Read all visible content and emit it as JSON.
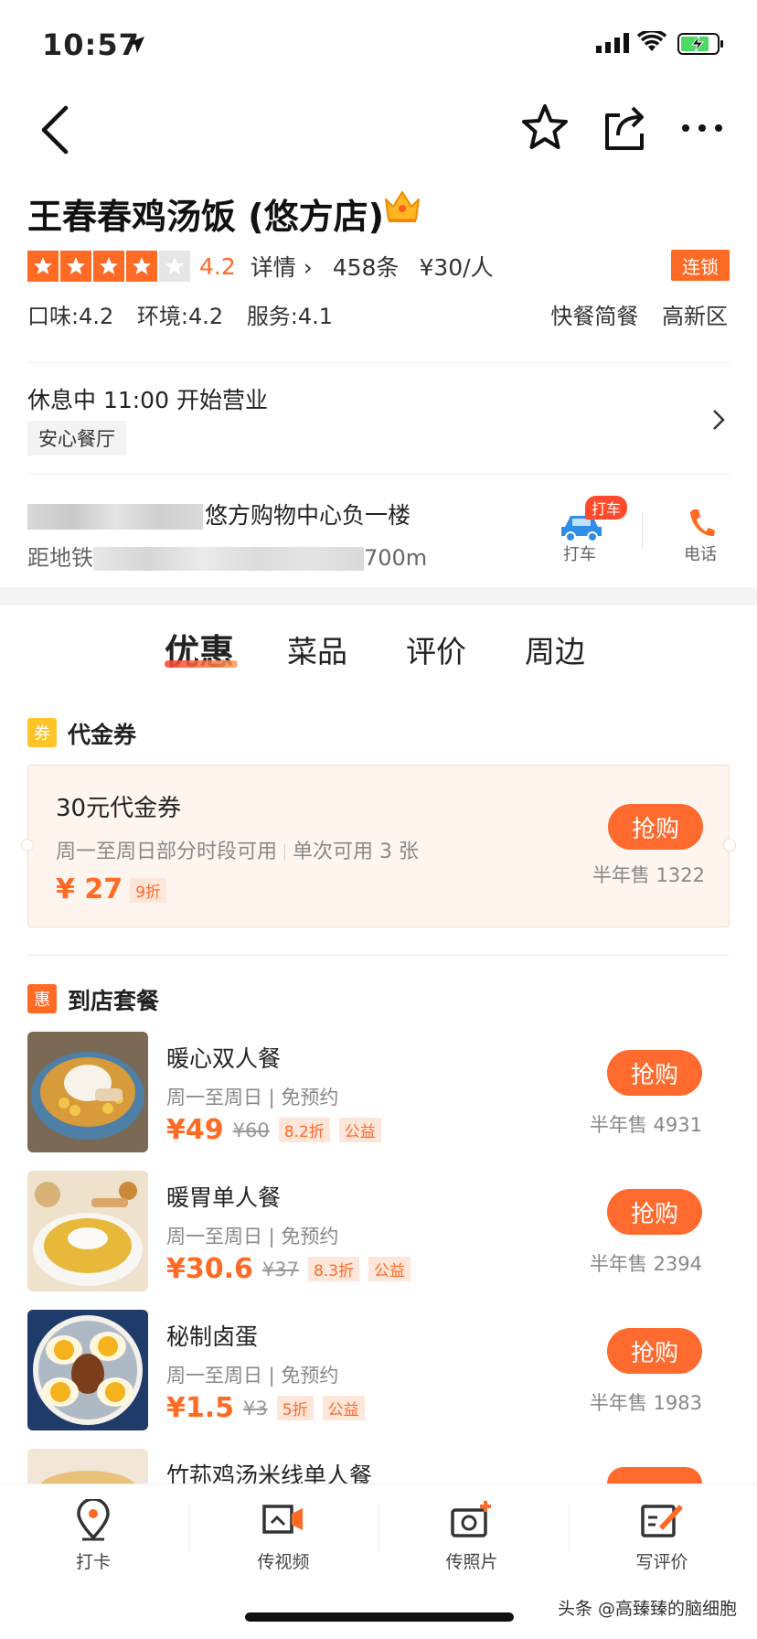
{
  "status_bar": {
    "time": "10:57"
  },
  "shop": {
    "name": "王春春鸡汤饭 (悠方店)",
    "score": "4.2",
    "rating_stars": 4,
    "detail_label": "详情 ›",
    "review_count": "458条",
    "per_person": "¥30/人",
    "chain_badge": "连锁",
    "sub_scores": [
      "口味:4.2",
      "环境:4.2",
      "服务:4.1"
    ],
    "categories": [
      "快餐简餐",
      "高新区"
    ],
    "hours": "休息中 11:00 开始营业",
    "safe_tag": "安心餐厅",
    "address_visible": "悠方购物中心负一楼",
    "distance_prefix": "距地铁",
    "distance_suffix": "700m"
  },
  "actions": {
    "taxi_badge": "打车",
    "taxi_label": "打车",
    "phone_label": "电话"
  },
  "tabs": [
    "优惠",
    "菜品",
    "评价",
    "周边"
  ],
  "voucher_section": {
    "icon": "券",
    "title": "代金券",
    "coupon": {
      "title": "30元代金券",
      "desc_a": "周一至周日部分时段可用",
      "desc_b": "单次可用 3 张",
      "price": "¥ 27",
      "discount": "9折",
      "buy_label": "抢购",
      "sold": "半年售 1322"
    }
  },
  "package_section": {
    "icon": "惠",
    "title": "到店套餐",
    "items": [
      {
        "name": "暖心双人餐",
        "desc": "周一至周日 | 免预约",
        "price": "¥49",
        "orig": "¥60",
        "discount": "8.2折",
        "tag": "公益",
        "buy_label": "抢购",
        "sold": "半年售 4931"
      },
      {
        "name": "暖胃单人餐",
        "desc": "周一至周日 | 免预约",
        "price": "¥30.6",
        "orig": "¥37",
        "discount": "8.3折",
        "tag": "公益",
        "buy_label": "抢购",
        "sold": "半年售 2394"
      },
      {
        "name": "秘制卤蛋",
        "desc": "周一至周日 | 免预约",
        "price": "¥1.5",
        "orig": "¥3",
        "discount": "5折",
        "tag": "公益",
        "buy_label": "抢购",
        "sold": "半年售 1983"
      },
      {
        "name": "竹荪鸡汤米线单人餐",
        "buy_label": "抢购"
      }
    ]
  },
  "bottom_bar": {
    "items": [
      {
        "label": "打卡",
        "icon": "location-pin-icon"
      },
      {
        "label": "传视频",
        "icon": "video-upload-icon"
      },
      {
        "label": "传照片",
        "icon": "camera-add-icon"
      },
      {
        "label": "写评价",
        "icon": "write-review-icon"
      }
    ]
  },
  "watermark": "头条 @高臻臻的脑细胞",
  "colors": {
    "accent": "#ff6a24",
    "badge_red": "#ff4a2b"
  }
}
